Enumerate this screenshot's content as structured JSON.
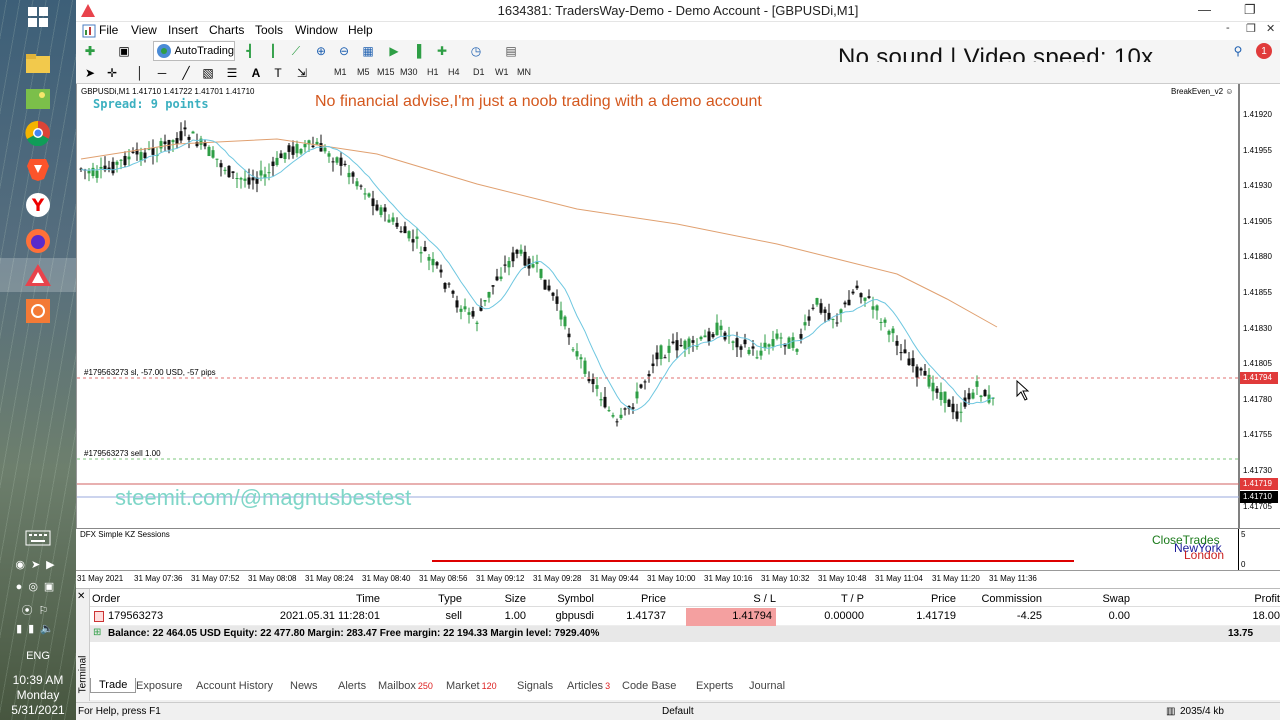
{
  "window": {
    "title": "1634381: TradersWay-Demo - Demo Account - [GBPUSDi,M1]"
  },
  "menu": [
    "File",
    "View",
    "Insert",
    "Charts",
    "Tools",
    "Window",
    "Help"
  ],
  "toolbar": {
    "autotrading": "AutoTrading",
    "timeframes": [
      "M1",
      "M5",
      "M15",
      "M30",
      "H1",
      "H4",
      "D1",
      "W1",
      "MN"
    ]
  },
  "overlay": {
    "speed": "No sound | Video speed: 10x",
    "disclaimer": "No financial advise,I'm just a noob trading with a demo account",
    "watermark": "steemit.com/@magnusbestest"
  },
  "chart": {
    "symbol_line": "GBPUSDi,M1  1.41710 1.41722 1.41701 1.41710",
    "spread": "Spread: 9 points",
    "ea": "BreakEven_v2 ☺",
    "sl_label": "#179563273 sl, -57.00 USD, -57 pips",
    "sell_label": "#179563273 sell 1.00",
    "price_labels": [
      "1.41920",
      "1.41955",
      "1.41930",
      "1.41905",
      "1.41880",
      "1.41855",
      "1.41830",
      "1.41805",
      "1.41780",
      "1.41755",
      "1.41730",
      "1.41705"
    ],
    "sl_price": "1.41794",
    "bid_price": "1.41719",
    "cur_price": "1.41710",
    "subwindow_title": "DFX Simple KZ Sessions",
    "session_labels": [
      "CloseTrades",
      "NewYork",
      "London"
    ],
    "time_labels": [
      "31 May 2021",
      "31 May 07:36",
      "31 May 07:52",
      "31 May 08:08",
      "31 May 08:24",
      "31 May 08:40",
      "31 May 08:56",
      "31 May 09:12",
      "31 May 09:28",
      "31 May 09:44",
      "31 May 10:00",
      "31 May 10:16",
      "31 May 10:32",
      "31 May 10:48",
      "31 May 11:04",
      "31 May 11:20",
      "31 May 11:36"
    ]
  },
  "terminal": {
    "headers": [
      "Order",
      "Time",
      "Type",
      "Size",
      "Symbol",
      "Price",
      "S / L",
      "T / P",
      "Price",
      "Commission",
      "Swap",
      "Profit"
    ],
    "row": [
      "179563273",
      "2021.05.31 11:28:01",
      "sell",
      "1.00",
      "gbpusdi",
      "1.41737",
      "1.41794",
      "0.00000",
      "1.41719",
      "-4.25",
      "0.00",
      "18.00"
    ],
    "balance_line": "Balance: 22 464.05 USD  Equity: 22 477.80  Margin: 283.47  Free margin: 22 194.33  Margin level: 7929.40%",
    "total": "13.75",
    "tabs": [
      "Trade",
      "Exposure",
      "Account History",
      "News",
      "Alerts",
      "Mailbox",
      "Market",
      "Signals",
      "Articles",
      "Code Base",
      "Experts",
      "Journal"
    ],
    "badges": {
      "Mailbox": "250",
      "Market": "120",
      "Articles": "3"
    },
    "side_label": "Terminal"
  },
  "status": {
    "help": "For Help, press F1",
    "profile": "Default",
    "traffic": "2035/4 kb"
  },
  "taskbar": {
    "lang": "ENG",
    "time": "10:39 AM",
    "day": "Monday",
    "date": "5/31/2021"
  },
  "colors": {
    "bull": "#2e9e45",
    "bear": "#111111",
    "ma_fast": "#6ec7e0",
    "ma_slow": "#e0a070",
    "sl": "#e04040",
    "overlay_orange": "#d4581e",
    "watermark": "#7fd6c8"
  }
}
